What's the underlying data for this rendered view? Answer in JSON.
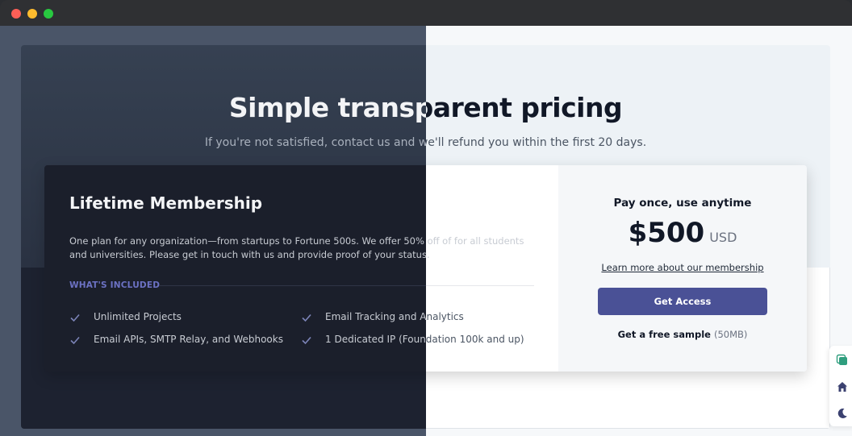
{
  "window": {
    "buttons": [
      "close",
      "minimize",
      "maximize"
    ]
  },
  "hero": {
    "title": "Simple transparent pricing",
    "subtitle": "If you're not satisfied, contact us and we'll refund you within the first 20 days."
  },
  "plan": {
    "name": "Lifetime Membership",
    "description": "One plan for any organization—from startups to Fortune 500s. We offer 50% off of for all students and universities. Please get in touch with us and provide proof of your status.",
    "included_label": "WHAT'S INCLUDED",
    "features": [
      "Unlimited Projects",
      "Email APIs, SMTP Relay, and Webhooks",
      "Email Tracking and Analytics",
      "1 Dedicated IP (Foundation 100k and up)"
    ]
  },
  "purchase": {
    "tagline": "Pay once, use anytime",
    "price": "$500",
    "currency": "USD",
    "learn_more": "Learn more about our membership",
    "cta_label": "Get Access",
    "sample_label": "Get a free sample",
    "sample_size": "(50MB)"
  },
  "side_tools": {
    "icons": [
      "copy-icon",
      "home-icon",
      "moon-icon"
    ]
  },
  "colors": {
    "accent": "#4a5196",
    "included_label": "#6c72c4",
    "check": "#7c84b8"
  }
}
